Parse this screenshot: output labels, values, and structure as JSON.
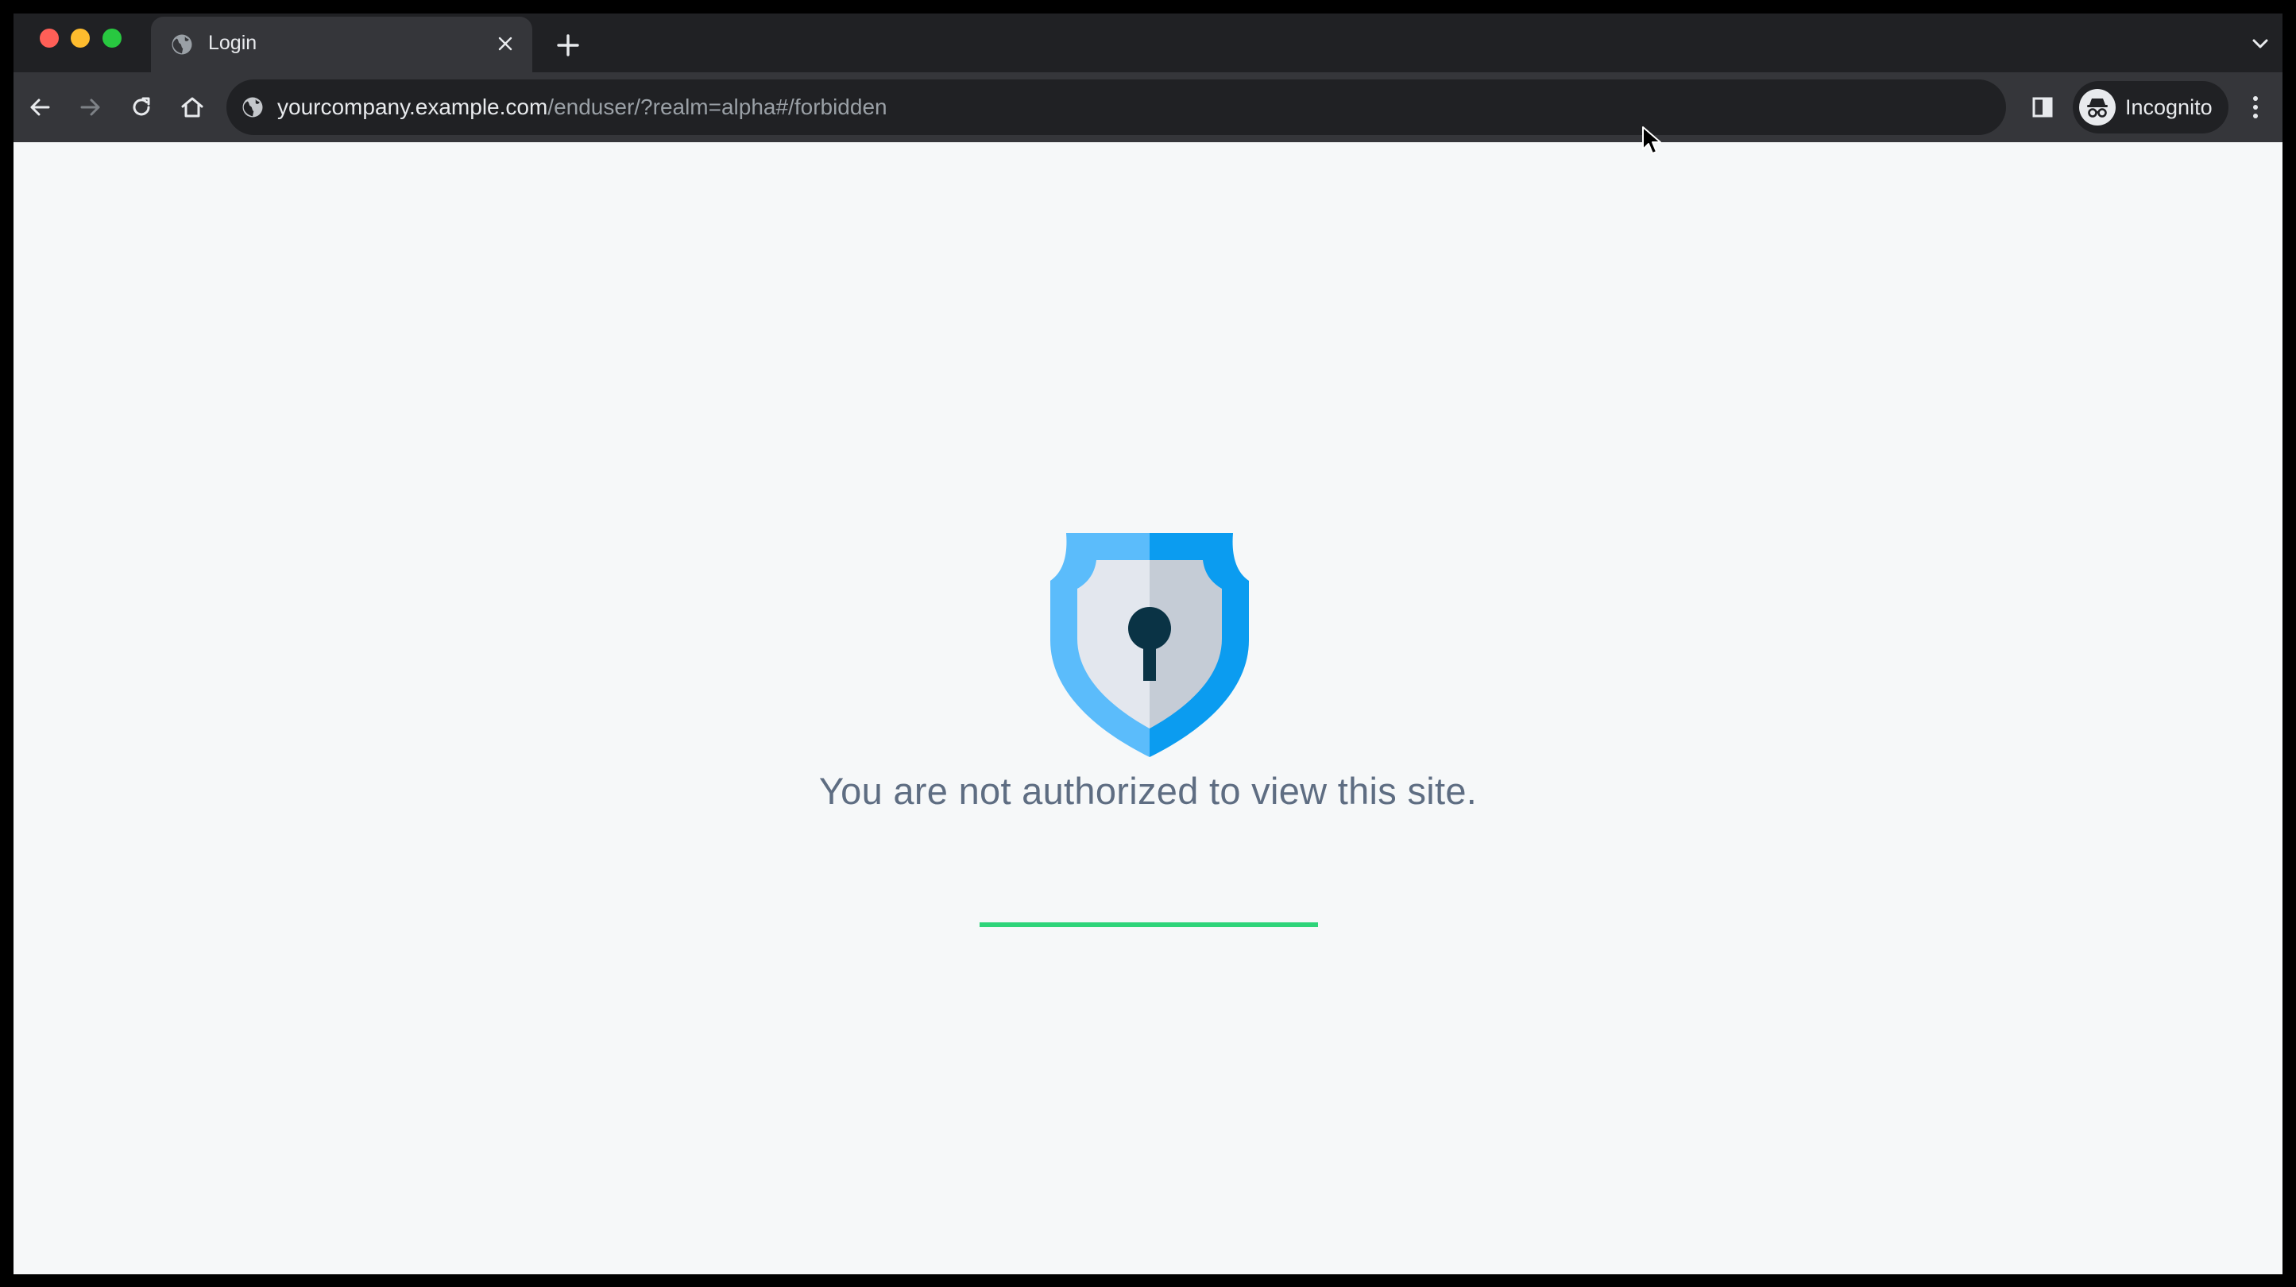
{
  "browser": {
    "tab": {
      "title": "Login"
    },
    "address_bar": {
      "host": "yourcompany.example.com",
      "path": "/enduser/?realm=alpha#/forbidden"
    },
    "profile": {
      "label": "Incognito"
    }
  },
  "page": {
    "message": "You are not authorized to view this site.",
    "progress": 1.0,
    "icon": "shield-keyhole-icon"
  },
  "colors": {
    "progress": "#2ed47a",
    "shield_light": "#5bbcfb",
    "shield_dark": "#0b9cf0",
    "message_text": "#5e6d82"
  }
}
